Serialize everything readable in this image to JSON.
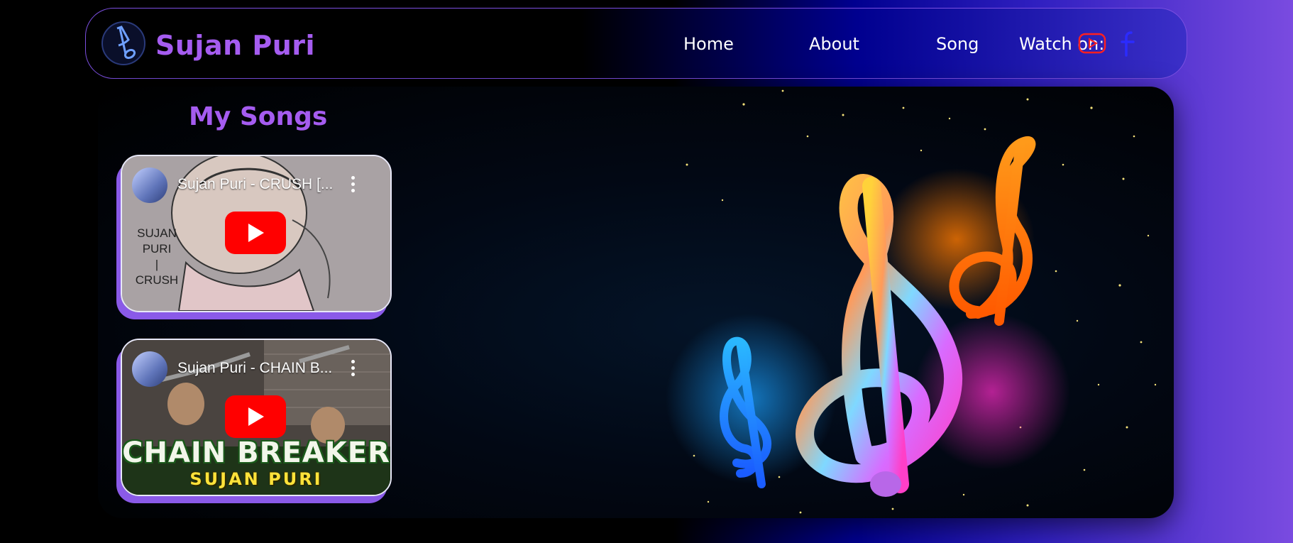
{
  "header": {
    "brand": "Sujan Puri",
    "nav": [
      {
        "label": "Home"
      },
      {
        "label": "About"
      },
      {
        "label": "Song"
      }
    ],
    "watch_label": "Watch on:",
    "icons": [
      "music-note-logo-icon",
      "youtube-icon",
      "facebook-icon"
    ]
  },
  "main": {
    "section_title": "My Songs",
    "videos": [
      {
        "title": "Sujan Puri - CRUSH [...",
        "thumbnail_text": [
          "SUJAN",
          "PURI",
          "|",
          "CRUSH"
        ]
      },
      {
        "title": "Sujan Puri - CHAIN B...",
        "thumbnail_text": [
          "CHAIN BREAKER",
          "SUJAN PURI"
        ]
      }
    ],
    "hero_art": "treble-clefs-icon"
  },
  "colors": {
    "accent": "#a55cf0",
    "youtube_red": "#ff0000",
    "facebook_blue": "#2b2bff"
  }
}
